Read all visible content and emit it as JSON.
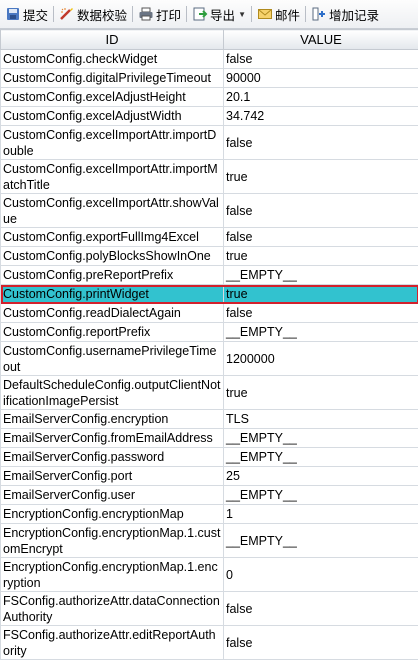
{
  "toolbar": {
    "submit": "提交",
    "validate": "数据校验",
    "print": "打印",
    "export": "导出",
    "mail": "邮件",
    "add_record": "增加记录"
  },
  "table": {
    "headers": [
      "ID",
      "VALUE"
    ],
    "selected_index": 12,
    "rows": [
      {
        "id": "CustomConfig.checkWidget",
        "value": "false"
      },
      {
        "id": "CustomConfig.digitalPrivilegeTimeout",
        "value": "90000"
      },
      {
        "id": "CustomConfig.excelAdjustHeight",
        "value": "20.1"
      },
      {
        "id": "CustomConfig.excelAdjustWidth",
        "value": "34.742"
      },
      {
        "id": "CustomConfig.excelImportAttr.importDouble",
        "value": "false"
      },
      {
        "id": "CustomConfig.excelImportAttr.importMatchTitle",
        "value": "true"
      },
      {
        "id": "CustomConfig.excelImportAttr.showValue",
        "value": "false"
      },
      {
        "id": "CustomConfig.exportFullImg4Excel",
        "value": "false"
      },
      {
        "id": "CustomConfig.polyBlocksShowInOne",
        "value": "true"
      },
      {
        "id": "CustomConfig.preReportPrefix",
        "value": "__EMPTY__"
      },
      {
        "id": "CustomConfig.printWidget",
        "value": "true"
      },
      {
        "id": "CustomConfig.readDialectAgain",
        "value": "false"
      },
      {
        "id": "CustomConfig.reportPrefix",
        "value": "__EMPTY__"
      },
      {
        "id": "CustomConfig.usernamePrivilegeTimeout",
        "value": "1200000"
      },
      {
        "id": "DefaultScheduleConfig.outputClientNotificationImagePersist",
        "value": "true"
      },
      {
        "id": "EmailServerConfig.encryption",
        "value": "TLS"
      },
      {
        "id": "EmailServerConfig.fromEmailAddress",
        "value": "__EMPTY__"
      },
      {
        "id": "EmailServerConfig.password",
        "value": "__EMPTY__"
      },
      {
        "id": "EmailServerConfig.port",
        "value": "25"
      },
      {
        "id": "EmailServerConfig.user",
        "value": "__EMPTY__"
      },
      {
        "id": "EncryptionConfig.encryptionMap",
        "value": "1"
      },
      {
        "id": "EncryptionConfig.encryptionMap.1.customEncrypt",
        "value": "__EMPTY__"
      },
      {
        "id": "EncryptionConfig.encryptionMap.1.encryption",
        "value": "0"
      },
      {
        "id": "FSConfig.authorizeAttr.dataConnectionAuthority",
        "value": "false"
      },
      {
        "id": "FSConfig.authorizeAttr.editReportAuthority",
        "value": "false"
      }
    ]
  }
}
